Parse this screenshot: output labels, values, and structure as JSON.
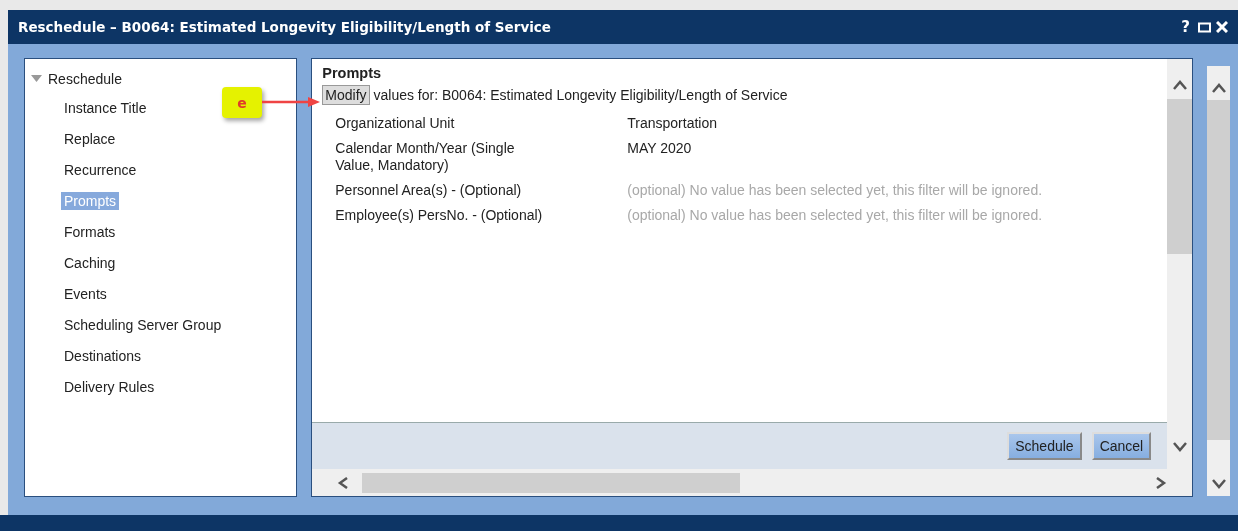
{
  "window": {
    "title": "Reschedule – B0064: Estimated Longevity Eligibility/Length of Service",
    "controls": [
      "?"
    ]
  },
  "sidebar": {
    "label": "Reschedule",
    "expanded": true,
    "children": [
      {
        "label": "Instance Title",
        "selected": false
      },
      {
        "label": "Replace",
        "selected": false
      },
      {
        "label": "Recurrence",
        "selected": false
      },
      {
        "label": "Prompts",
        "selected": true
      },
      {
        "label": "Formats",
        "selected": false
      },
      {
        "label": "Caching",
        "selected": false
      },
      {
        "label": "Events",
        "selected": false
      },
      {
        "label": "Scheduling Server Group",
        "selected": false
      },
      {
        "label": "Destinations",
        "selected": false
      },
      {
        "label": "Delivery Rules",
        "selected": false
      }
    ]
  },
  "prompts": {
    "heading": "Prompts",
    "modify_button": "Modify",
    "intro": "values for: B0064: Estimated Longevity Eligibility/Length of Service",
    "rows": [
      {
        "name": "Organizational Unit",
        "value": "Transportation",
        "optional": false
      },
      {
        "name": "Calendar Month/Year (Single Value, Mandatory)",
        "value": "MAY 2020",
        "optional": false
      },
      {
        "name": "Personnel Area(s) - (Optional)",
        "value": "(optional) No value has been selected yet, this filter will be ignored.",
        "optional": true
      },
      {
        "name": "Employee(s) PersNo. - (Optional)",
        "value": "(optional) No value has been selected yet, this filter will be ignored.",
        "optional": true
      }
    ]
  },
  "buttons": [
    {
      "label": "Schedule"
    },
    {
      "label": "Cancel"
    }
  ],
  "callout": {
    "label": "e"
  }
}
